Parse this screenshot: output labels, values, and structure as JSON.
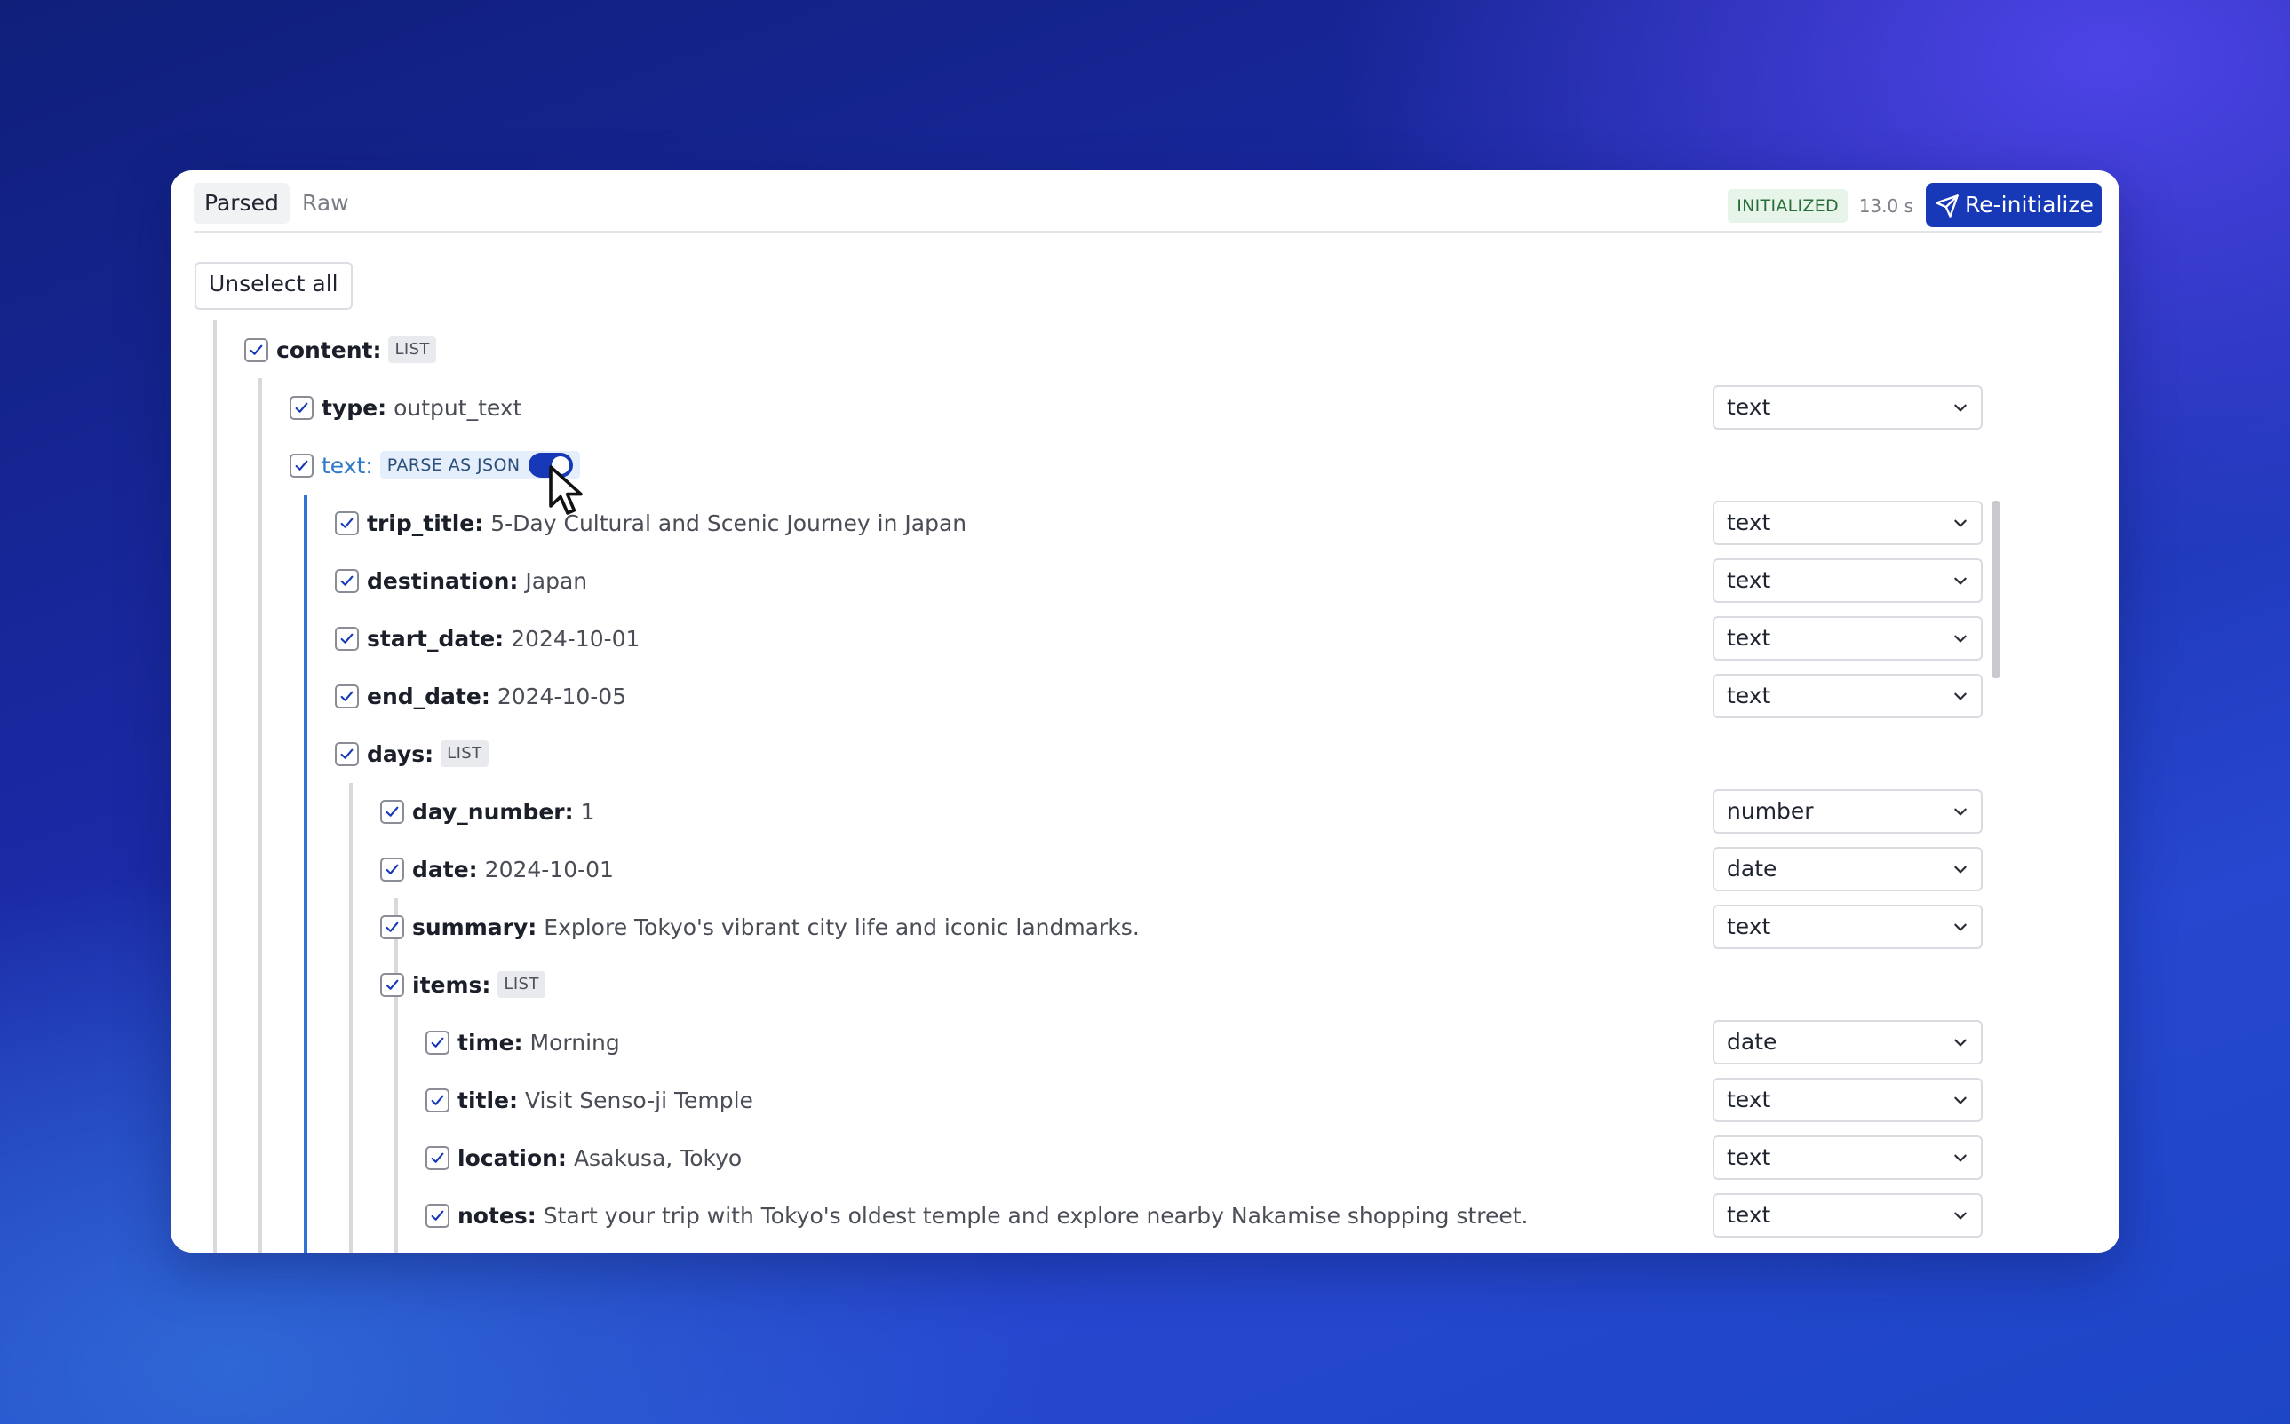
{
  "tabs": [
    {
      "label": "Parsed",
      "active": true
    },
    {
      "label": "Raw",
      "active": false
    }
  ],
  "status": {
    "badge": "INITIALIZED",
    "elapsed": "13.0 s"
  },
  "actions": {
    "reinitialize_label": "Re-initialize",
    "unselect_all_label": "Unselect all"
  },
  "colors": {
    "accent": "#1739b8",
    "link": "#2d79c7",
    "success_text": "#2a6f3a",
    "success_bg": "#e7f4e9"
  },
  "tree": {
    "content": {
      "key": "content:",
      "badge": "LIST"
    },
    "type": {
      "key": "type:",
      "value": "output_text",
      "format": "text"
    },
    "text": {
      "key": "text:",
      "badge": "PARSE AS JSON",
      "parse_as_json": true
    },
    "trip_title": {
      "key": "trip_title:",
      "value": "5-Day Cultural and Scenic Journey in Japan",
      "format": "text"
    },
    "destination": {
      "key": "destination:",
      "value": "Japan",
      "format": "text"
    },
    "start_date": {
      "key": "start_date:",
      "value": "2024-10-01",
      "format": "text"
    },
    "end_date": {
      "key": "end_date:",
      "value": "2024-10-05",
      "format": "text"
    },
    "days": {
      "key": "days:",
      "badge": "LIST"
    },
    "day_number": {
      "key": "day_number:",
      "value": "1",
      "format": "number"
    },
    "date": {
      "key": "date:",
      "value": "2024-10-01",
      "format": "date"
    },
    "summary": {
      "key": "summary:",
      "value": "Explore Tokyo's vibrant city life and iconic landmarks.",
      "format": "text"
    },
    "items": {
      "key": "items:",
      "badge": "LIST"
    },
    "time": {
      "key": "time:",
      "value": "Morning",
      "format": "date"
    },
    "title": {
      "key": "title:",
      "value": "Visit Senso-ji Temple",
      "format": "text"
    },
    "location": {
      "key": "location:",
      "value": "Asakusa, Tokyo",
      "format": "text"
    },
    "notes": {
      "key": "notes:",
      "value": "Start your trip with Tokyo's oldest temple and explore nearby Nakamise shopping street.",
      "format": "text"
    }
  }
}
